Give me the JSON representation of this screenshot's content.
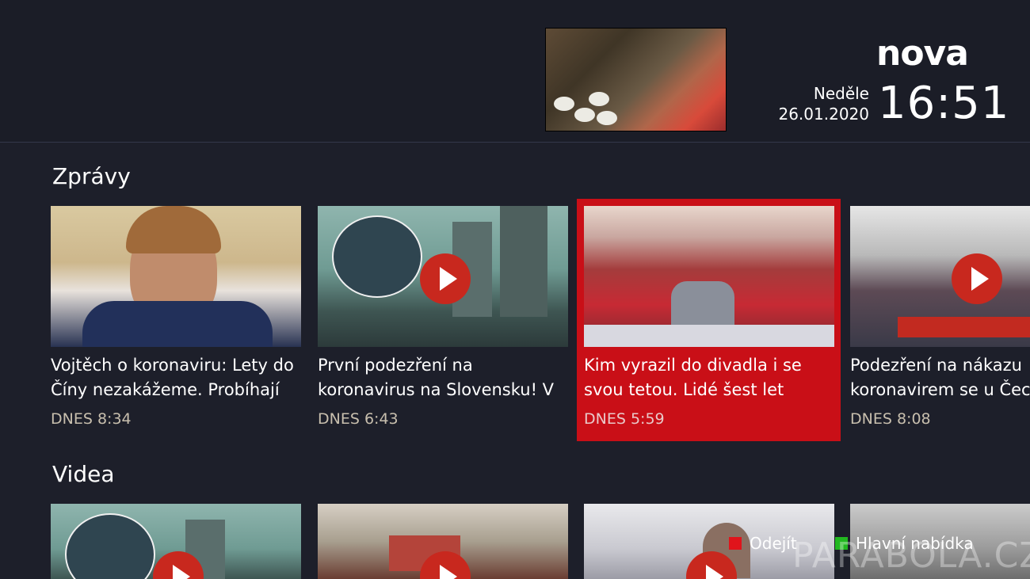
{
  "header": {
    "logo": "nova",
    "day": "Neděle",
    "date": "26.01.2020",
    "time": "16:51"
  },
  "sections": [
    {
      "title": "Zprávy",
      "items": [
        {
          "title_line1": "Vojtěch o koronaviru: Lety do",
          "title_line2": "Číny nezakážeme. Probíhají",
          "time": "DNES 8:34",
          "play": false
        },
        {
          "title_line1": "První podezření na",
          "title_line2": "koronavirus na Slovensku! V",
          "time": "DNES 6:43",
          "play": true
        },
        {
          "title_line1": "Kim vyrazil do divadla i se",
          "title_line2": "svou tetou. Lidé šest let",
          "time": "DNES 5:59",
          "play": false,
          "selected": true
        },
        {
          "title_line1": "Podezření na nákazu",
          "title_line2": "koronavirem se u Čech",
          "time": "DNES 8:08",
          "play": true
        }
      ]
    },
    {
      "title": "Videa"
    }
  ],
  "legend": {
    "red_label": "Odejít",
    "green_label": "Hlavní nabídka",
    "red_color": "#e0141b",
    "green_color": "#22b820"
  },
  "watermark": "PARABOLA.CZ",
  "colors": {
    "background": "#1d1f2a",
    "selected": "#c90f17",
    "time_text": "#c8bfae"
  }
}
